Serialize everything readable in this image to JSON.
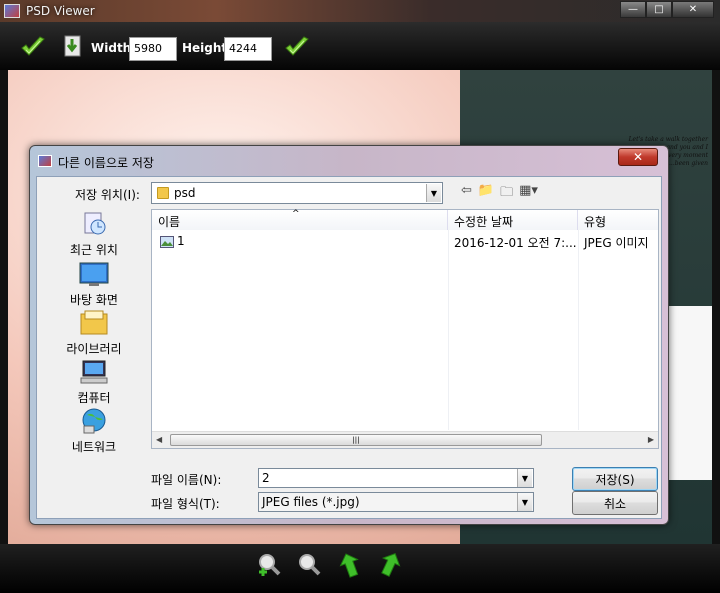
{
  "window": {
    "title": "PSD Viewer",
    "minimize": "—",
    "maximize": "□",
    "close": "✕"
  },
  "toolbar": {
    "width_label": "Width",
    "width_value": "5980",
    "height_label": "Height",
    "height_value": "4244"
  },
  "canvas": {
    "poem_lines": [
      "Let's take a walk together",
      "...and you and I",
      "...every moment",
      "...been given"
    ]
  },
  "dialog": {
    "title": "다른 이름으로 저장",
    "close": "✕",
    "location_label": "저장 위치(I):",
    "location_value": "psd",
    "places": [
      {
        "label": "최근 위치",
        "icon": "recent-places-icon"
      },
      {
        "label": "바탕 화면",
        "icon": "desktop-icon"
      },
      {
        "label": "라이브러리",
        "icon": "libraries-icon"
      },
      {
        "label": "컴퓨터",
        "icon": "computer-icon"
      },
      {
        "label": "네트워크",
        "icon": "network-icon"
      }
    ],
    "columns": [
      "이름",
      "수정한 날짜",
      "유형"
    ],
    "files": [
      {
        "name": "1",
        "modified": "2016-12-01 오전 7:...",
        "type": "JPEG 이미지"
      }
    ],
    "filename_label": "파일 이름(N):",
    "filename_value": "2",
    "filetype_label": "파일 형식(T):",
    "filetype_value": "JPEG files (*.jpg)",
    "save_button": "저장(S)",
    "cancel_button": "취소"
  },
  "colors": {
    "accent_check": "#7fd23a",
    "dialog_close": "#c0392b"
  }
}
